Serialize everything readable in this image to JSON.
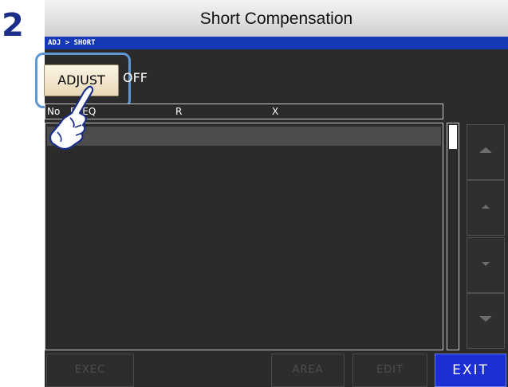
{
  "step": {
    "number": "2"
  },
  "window": {
    "title": "Short Compensation",
    "breadcrumb": "ADJ > SHORT"
  },
  "adjust": {
    "button_label": "ADJUST",
    "state": "OFF"
  },
  "list": {
    "columns": [
      {
        "label": "No"
      },
      {
        "label": "FREQ"
      },
      {
        "label": "R"
      },
      {
        "label": "X"
      }
    ]
  },
  "bottom": {
    "exec_label": "EXEC",
    "area_label": "AREA",
    "edit_label": "EDIT",
    "exit_label": "EXIT"
  },
  "colors": {
    "accent": "#1637b6",
    "exit_button": "#1b2fd4",
    "screen_background": "#2b2b2b",
    "highlight": "#5f97d4"
  },
  "icons": {
    "pointer": "pointing-hand-icon"
  }
}
